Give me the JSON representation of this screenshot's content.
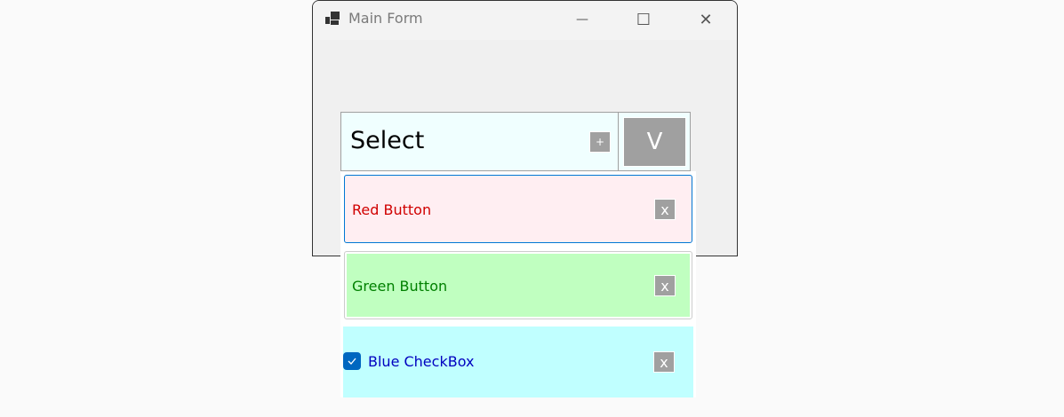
{
  "window": {
    "title": "Main Form",
    "minimize": "—",
    "maximize": "☐",
    "close": "✕"
  },
  "select": {
    "text": "Select",
    "add_label": "+",
    "dropdown_label": "V"
  },
  "items": [
    {
      "label": "Red Button",
      "remove": "x",
      "color": "#d00000",
      "bg": "#ffeef2"
    },
    {
      "label": "Green Button",
      "remove": "x",
      "color": "#008000",
      "bg": "#c0ffc0"
    },
    {
      "label": "Blue CheckBox",
      "remove": "x",
      "color": "#0000c0",
      "bg": "#c0ffff",
      "checked": true
    }
  ]
}
